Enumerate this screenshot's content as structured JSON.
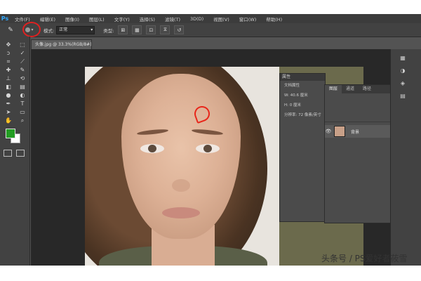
{
  "app": {
    "logo": "Ps"
  },
  "menubar": {
    "items": [
      "文件(F)",
      "编辑(E)",
      "图像(I)",
      "图层(L)",
      "文字(Y)",
      "选择(S)",
      "滤镜(T)",
      "3D(D)",
      "视图(V)",
      "窗口(W)",
      "帮助(H)"
    ]
  },
  "options": {
    "mode_label": "模式:",
    "mode_value": "正常",
    "type_label": "类型:"
  },
  "document": {
    "tab_title": "头像.jpg @ 33.3%(RGB/8#)"
  },
  "properties": {
    "title": "属性",
    "header": "文档属性",
    "rows": [
      "W: 40.6 厘米",
      "H: 0 厘米",
      "分辨率: 72 像素/英寸"
    ]
  },
  "layers": {
    "tabs": [
      "图层",
      "通道",
      "路径"
    ],
    "layer_name": "背景"
  },
  "watermark": "头条号 / PS爱好者莜雪",
  "colors": {
    "foreground": "#239d23",
    "background": "#ffffff",
    "annotation": "#e8261a"
  }
}
